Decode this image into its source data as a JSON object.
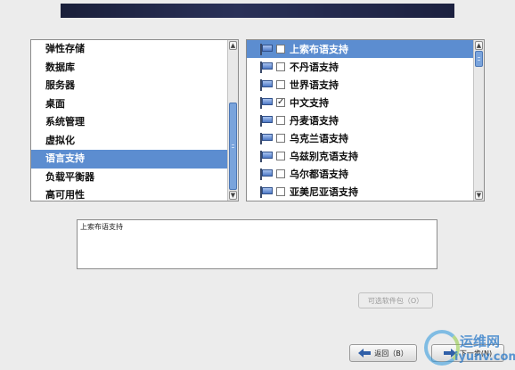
{
  "categories": [
    {
      "label": "弹性存储",
      "selected": false
    },
    {
      "label": "数据库",
      "selected": false
    },
    {
      "label": "服务器",
      "selected": false
    },
    {
      "label": "桌面",
      "selected": false
    },
    {
      "label": "系统管理",
      "selected": false
    },
    {
      "label": "虚拟化",
      "selected": false
    },
    {
      "label": "语言支持",
      "selected": true
    },
    {
      "label": "负载平衡器",
      "selected": false
    },
    {
      "label": "高可用性",
      "selected": false
    }
  ],
  "groups": [
    {
      "label": "上索布语支持",
      "checked": false,
      "selected": true
    },
    {
      "label": "不丹语支持",
      "checked": false,
      "selected": false
    },
    {
      "label": "世界语支持",
      "checked": false,
      "selected": false
    },
    {
      "label": "中文支持",
      "checked": true,
      "selected": false
    },
    {
      "label": "丹麦语支持",
      "checked": false,
      "selected": false
    },
    {
      "label": "乌克兰语支持",
      "checked": false,
      "selected": false
    },
    {
      "label": "乌兹别克语支持",
      "checked": false,
      "selected": false
    },
    {
      "label": "乌尔都语支持",
      "checked": false,
      "selected": false
    },
    {
      "label": "亚美尼亚语支持",
      "checked": false,
      "selected": false
    }
  ],
  "description": "上索布语支持",
  "buttons": {
    "optional_packages": "可选软件包（O）",
    "back": "返回（B）",
    "next": "下一步(N)"
  },
  "watermark": {
    "line1": "运维网",
    "line2": "iyunv.com"
  },
  "icons": {
    "flag": "flag-icon",
    "back": "arrow-left-icon",
    "next": "arrow-right-icon"
  },
  "colors": {
    "selection": "#5c8dd0",
    "header_bar": "#1a1f3a"
  }
}
